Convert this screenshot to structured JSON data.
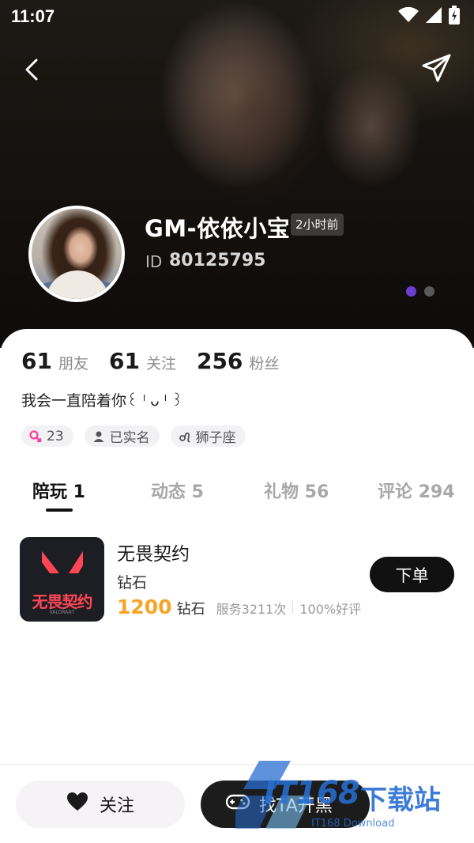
{
  "status_bar": {
    "time": "11:07"
  },
  "profile": {
    "nickname": "GM-依依小宝",
    "last_active": "2小时前",
    "id_label": "ID",
    "id_value": "80125795"
  },
  "stats": [
    {
      "value": "61",
      "label": "朋友"
    },
    {
      "value": "61",
      "label": "关注"
    },
    {
      "value": "256",
      "label": "粉丝"
    }
  ],
  "bio": "我会一直陪着你꒰ ˡ ᴗ ˡ ꒱",
  "tags": [
    {
      "icon": "female-icon",
      "label": "23",
      "color": "#ff3e9c"
    },
    {
      "icon": "person-icon",
      "label": "已实名"
    },
    {
      "icon": "leo-icon",
      "label": "狮子座"
    }
  ],
  "tabs": [
    {
      "label": "陪玩 1",
      "active": true
    },
    {
      "label": "动态 5",
      "active": false
    },
    {
      "label": "礼物 56",
      "active": false
    },
    {
      "label": "评论 294",
      "active": false
    }
  ],
  "service": {
    "game_icon_text": "无畏契约",
    "game_icon_sub": "VALORANT",
    "title": "无畏契约",
    "rank": "钻石",
    "price": "1200",
    "price_unit": "钻石",
    "service_count": "服务3211次",
    "rating": "100%好评",
    "order_label": "下单"
  },
  "bottom_bar": {
    "follow_label": "关注",
    "play_label": "找TA开黑"
  },
  "watermark": {
    "logo": "IT168",
    "chinese": "下载站",
    "sub": "IT168 Download"
  },
  "colors": {
    "accent_price": "#f6a526",
    "carousel_active": "#6b3fd6",
    "valorant_red": "#ff4655"
  }
}
